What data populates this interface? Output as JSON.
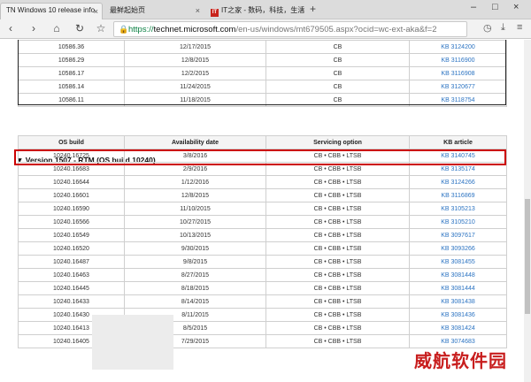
{
  "browser": {
    "tabs": [
      {
        "label": "TN Windows 10 release info",
        "active": true
      },
      {
        "label": "最鲜起始页",
        "active": false
      },
      {
        "label": "IT之家 - 数码，科技，生活",
        "active": false,
        "favicon": "IT"
      }
    ],
    "url": {
      "scheme": "https://",
      "host": "technet.microsoft.com",
      "path": "/en-us/windows/mt679505.aspx?ocid=wc-ext-aka&f=2"
    }
  },
  "columns": [
    "OS build",
    "Availability date",
    "Servicing option",
    "KB article"
  ],
  "upper_rows": [
    [
      "10586.36",
      "12/17/2015",
      "CB",
      "KB 3124200"
    ],
    [
      "10586.29",
      "12/8/2015",
      "CB",
      "KB 3116900"
    ],
    [
      "10586.17",
      "12/2/2015",
      "CB",
      "KB 3116908"
    ],
    [
      "10586.14",
      "11/24/2015",
      "CB",
      "KB 3120677"
    ],
    [
      "10586.11",
      "11/18/2015",
      "CB",
      "KB 3118754"
    ]
  ],
  "section_title": "▼ Version 1507 - RTM (OS build 10240)",
  "rows": [
    [
      "10240.16725",
      "3/8/2016",
      "CB • CBB • LTSB",
      "KB 3140745"
    ],
    [
      "10240.16683",
      "2/9/2016",
      "CB • CBB • LTSB",
      "KB 3135174"
    ],
    [
      "10240.16644",
      "1/12/2016",
      "CB • CBB • LTSB",
      "KB 3124266"
    ],
    [
      "10240.16601",
      "12/8/2015",
      "CB • CBB • LTSB",
      "KB 3116869"
    ],
    [
      "10240.16590",
      "11/10/2015",
      "CB • CBB • LTSB",
      "KB 3105213"
    ],
    [
      "10240.16566",
      "10/27/2015",
      "CB • CBB • LTSB",
      "KB 3105210"
    ],
    [
      "10240.16549",
      "10/13/2015",
      "CB • CBB • LTSB",
      "KB 3097617"
    ],
    [
      "10240.16520",
      "9/30/2015",
      "CB • CBB • LTSB",
      "KB 3093266"
    ],
    [
      "10240.16487",
      "9/8/2015",
      "CB • CBB • LTSB",
      "KB 3081455"
    ],
    [
      "10240.16463",
      "8/27/2015",
      "CB • CBB • LTSB",
      "KB 3081448"
    ],
    [
      "10240.16445",
      "8/18/2015",
      "CB • CBB • LTSB",
      "KB 3081444"
    ],
    [
      "10240.16433",
      "8/14/2015",
      "CB • CBB • LTSB",
      "KB 3081438"
    ],
    [
      "10240.16430",
      "8/11/2015",
      "CB • CBB • LTSB",
      "KB 3081436"
    ],
    [
      "10240.16413",
      "8/5/2015",
      "CB • CBB • LTSB",
      "KB 3081424"
    ],
    [
      "10240.16405",
      "7/29/2015",
      "CB • CBB • LTSB",
      "KB 3074683"
    ]
  ],
  "watermark": "威航软件园",
  "colors": {
    "link": "#2b73c2",
    "highlight": "#cc0000",
    "secure": "#0b8043"
  },
  "icons": [
    "back-icon",
    "forward-icon",
    "reload-icon",
    "bookmark-star-icon",
    "lock-icon",
    "history-icon",
    "download-icon",
    "menu-icon"
  ]
}
